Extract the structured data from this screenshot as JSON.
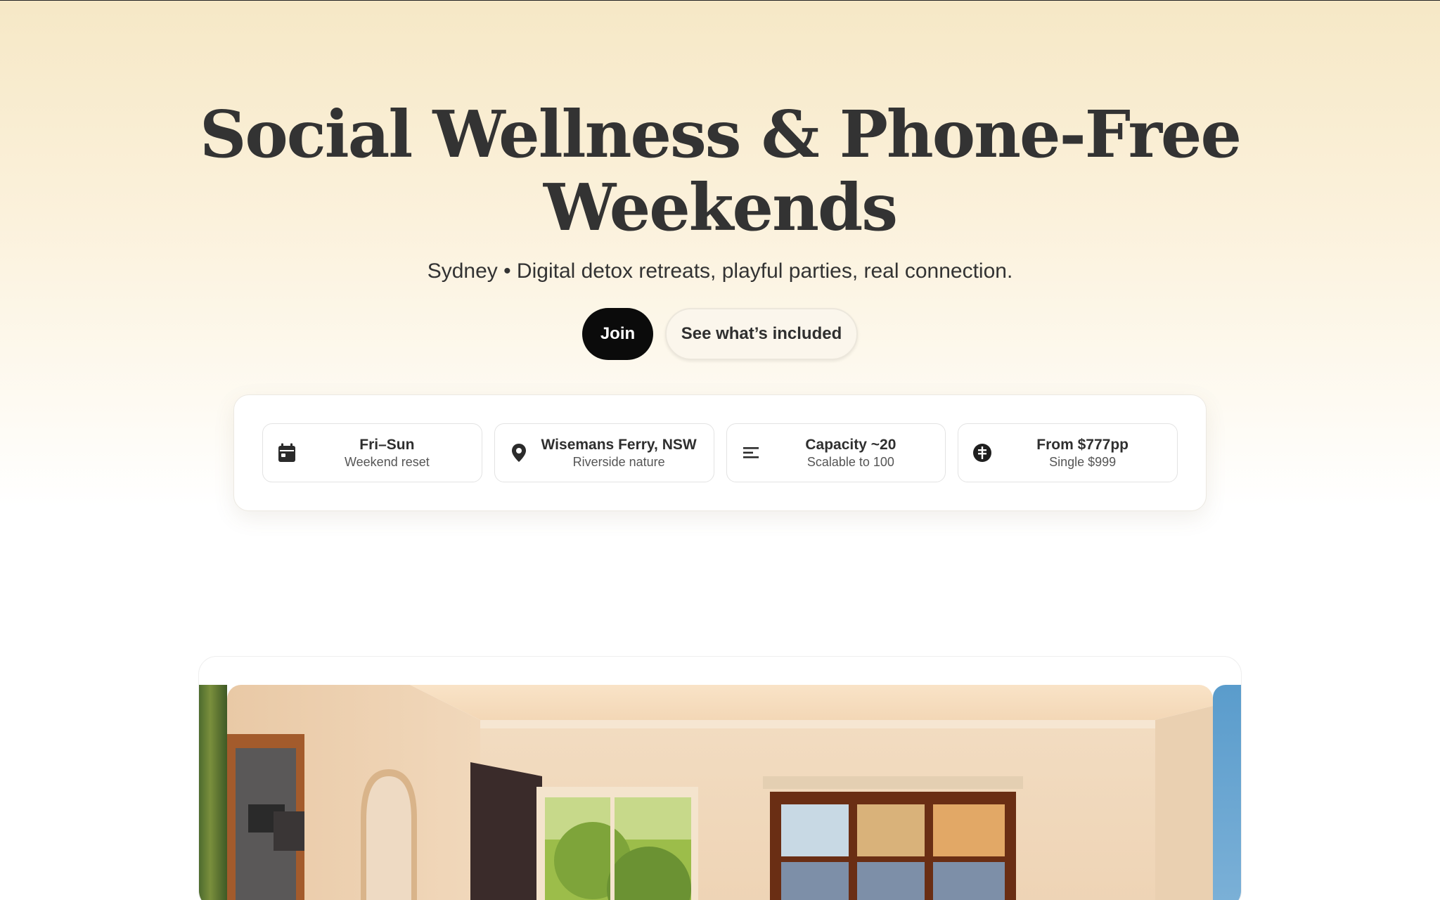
{
  "hero": {
    "title_line1": "Social Wellness & Phone-Free",
    "title_line2": "Weekends",
    "subtitle": "Sydney • Digital detox retreats, playful parties, real connection."
  },
  "cta": {
    "primary_label": "Join",
    "secondary_label": "See what’s included"
  },
  "info": {
    "items": [
      {
        "icon": "calendar-icon",
        "title": "Fri–Sun",
        "subtitle": "Weekend reset"
      },
      {
        "icon": "location-pin-icon",
        "title": "Wisemans Ferry, NSW",
        "subtitle": "Riverside nature"
      },
      {
        "icon": "lines-icon",
        "title": "Capacity ~20",
        "subtitle": "Scalable to 100"
      },
      {
        "icon": "dollar-coin-icon",
        "title": "From $777pp",
        "subtitle": "Single $999"
      }
    ]
  },
  "colors": {
    "primary_button": "#0b0b0b",
    "hero_gradient_top": "#f6e8c6",
    "text_dark": "#333333"
  },
  "gallery": {
    "images": [
      "bedroom-photo",
      "garden-photo",
      "sky-photo"
    ]
  }
}
